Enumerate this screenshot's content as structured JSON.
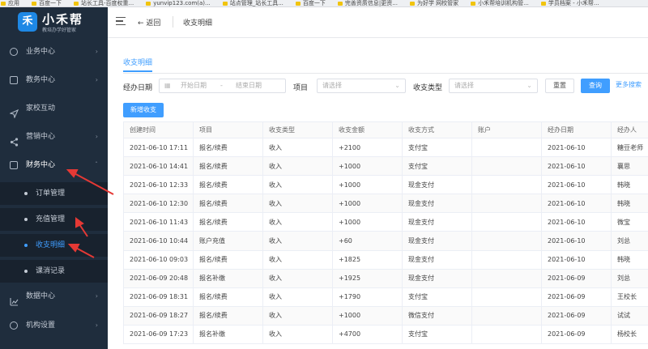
{
  "bookmarks": [
    "应用",
    "百度一下",
    "站长工具-百度权重...",
    "yunvip123.com(a)...",
    "站点管理_站长工具...",
    "百度一下",
    "完善资质信息|更资...",
    "为好学 网校管家",
    "小禾帮培训机构管...",
    "学员档案 - 小禾帮..."
  ],
  "logo": {
    "mark": "禾",
    "name": "小禾帮",
    "slogan": "教培办学好管家"
  },
  "sidebar": {
    "items": [
      {
        "label": "业务中心",
        "icon": "search-icon"
      },
      {
        "label": "教务中心",
        "icon": "book-icon"
      },
      {
        "label": "家校互动",
        "icon": "send-icon"
      },
      {
        "label": "营销中心",
        "icon": "share-icon"
      },
      {
        "label": "财务中心",
        "icon": "finance-icon"
      },
      {
        "label": "数据中心",
        "icon": "chart-icon"
      },
      {
        "label": "机构设置",
        "icon": "gear-icon"
      }
    ],
    "finance_sub": [
      {
        "label": "订单管理"
      },
      {
        "label": "充值管理"
      },
      {
        "label": "收支明细"
      },
      {
        "label": "课消记录"
      }
    ]
  },
  "topbar": {
    "back_label": "返回",
    "breadcrumb": "收支明细"
  },
  "tab": {
    "label": "收支明细"
  },
  "filters": {
    "date_label": "经办日期",
    "start_placeholder": "开始日期",
    "end_placeholder": "结束日期",
    "range_sep": "-",
    "item_label": "项目",
    "item_placeholder": "请选择",
    "type_label": "收支类型",
    "type_placeholder": "请选择",
    "reset_label": "重置",
    "query_label": "查询",
    "more_label": "更多搜索"
  },
  "add_button": "新增收支",
  "accent": "#409eff",
  "table": {
    "columns": [
      "创建时间",
      "项目",
      "收支类型",
      "收支金额",
      "收支方式",
      "账户",
      "经办日期",
      "经办人"
    ],
    "rows": [
      [
        "2021-06-10 17:11",
        "报名/续费",
        "收入",
        "+2100",
        "支付宝",
        "",
        "2021-06-10",
        "糖豆老师"
      ],
      [
        "2021-06-10 14:41",
        "报名/续费",
        "收入",
        "+1000",
        "支付宝",
        "",
        "2021-06-10",
        "襄思"
      ],
      [
        "2021-06-10 12:33",
        "报名/续费",
        "收入",
        "+1000",
        "现金支付",
        "",
        "2021-06-10",
        "韩晓"
      ],
      [
        "2021-06-10 12:30",
        "报名/续费",
        "收入",
        "+1000",
        "现金支付",
        "",
        "2021-06-10",
        "韩晓"
      ],
      [
        "2021-06-10 11:43",
        "报名/续费",
        "收入",
        "+1000",
        "现金支付",
        "",
        "2021-06-10",
        "微宝"
      ],
      [
        "2021-06-10 10:44",
        "账户充值",
        "收入",
        "+60",
        "现金支付",
        "",
        "2021-06-10",
        "刘总"
      ],
      [
        "2021-06-10 09:03",
        "报名/续费",
        "收入",
        "+1825",
        "现金支付",
        "",
        "2021-06-10",
        "韩晓"
      ],
      [
        "2021-06-09 20:48",
        "报名补缴",
        "收入",
        "+1925",
        "现金支付",
        "",
        "2021-06-09",
        "刘总"
      ],
      [
        "2021-06-09 18:31",
        "报名/续费",
        "收入",
        "+1790",
        "支付宝",
        "",
        "2021-06-09",
        "王校长"
      ],
      [
        "2021-06-09 18:27",
        "报名/续费",
        "收入",
        "+1000",
        "微信支付",
        "",
        "2021-06-09",
        "试试"
      ],
      [
        "2021-06-09 17:23",
        "报名补缴",
        "收入",
        "+4700",
        "支付宝",
        "",
        "2021-06-09",
        "杨校长"
      ]
    ]
  }
}
